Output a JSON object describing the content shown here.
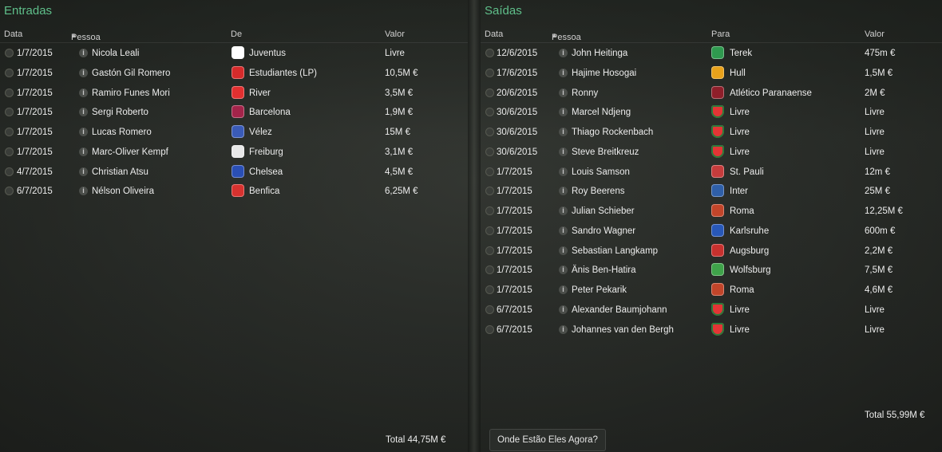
{
  "left": {
    "title": "Entradas",
    "headers": {
      "date": "Data",
      "person": "Pessoa",
      "club": "De",
      "value": "Valor"
    },
    "rows": [
      {
        "date": "1/7/2015",
        "person": "Nicola Leali",
        "club": "Juventus",
        "value": "Livre",
        "crest": "juventus-crest-icon",
        "color": "#ffffff"
      },
      {
        "date": "1/7/2015",
        "person": "Gastón Gil Romero",
        "club": "Estudiantes (LP)",
        "value": "10,5M €",
        "crest": "estudiantes-crest-icon",
        "color": "#d62b2b"
      },
      {
        "date": "1/7/2015",
        "person": "Ramiro Funes Mori",
        "club": "River",
        "value": "3,5M €",
        "crest": "river-crest-icon",
        "color": "#e23030"
      },
      {
        "date": "1/7/2015",
        "person": "Sergi Roberto",
        "club": "Barcelona",
        "value": "1,9M €",
        "crest": "barcelona-crest-icon",
        "color": "#a3244a"
      },
      {
        "date": "1/7/2015",
        "person": "Lucas Romero",
        "club": "Vélez",
        "value": "15M €",
        "crest": "velez-crest-icon",
        "color": "#3a5bb8"
      },
      {
        "date": "1/7/2015",
        "person": "Marc-Oliver Kempf",
        "club": "Freiburg",
        "value": "3,1M €",
        "crest": "freiburg-crest-icon",
        "color": "#e8e8e8"
      },
      {
        "date": "4/7/2015",
        "person": "Christian Atsu",
        "club": "Chelsea",
        "value": "4,5M €",
        "crest": "chelsea-crest-icon",
        "color": "#2a4fb5"
      },
      {
        "date": "6/7/2015",
        "person": "Nélson Oliveira",
        "club": "Benfica",
        "value": "6,25M €",
        "crest": "benfica-crest-icon",
        "color": "#d8322f"
      }
    ],
    "total": "Total  44,75M €"
  },
  "right": {
    "title": "Saídas",
    "headers": {
      "date": "Data",
      "person": "Pessoa",
      "club": "Para",
      "value": "Valor"
    },
    "rows": [
      {
        "date": "12/6/2015",
        "person": "John Heitinga",
        "club": "Terek",
        "value": "475m €",
        "crest": "terek-crest-icon",
        "color": "#2f9a4f"
      },
      {
        "date": "17/6/2015",
        "person": "Hajime Hosogai",
        "club": "Hull",
        "value": "1,5M €",
        "crest": "hull-crest-icon",
        "color": "#e9a21b"
      },
      {
        "date": "20/6/2015",
        "person": "Ronny",
        "club": "Atlético Paranaense",
        "value": "2M €",
        "crest": "atletico-paranaense-crest-icon",
        "color": "#8e1f2a"
      },
      {
        "date": "30/6/2015",
        "person": "Marcel Ndjeng",
        "club": "Livre",
        "value": "Livre",
        "crest": "free-agent-shield-icon",
        "color": "#e33535"
      },
      {
        "date": "30/6/2015",
        "person": "Thiago Rockenbach",
        "club": "Livre",
        "value": "Livre",
        "crest": "free-agent-shield-icon",
        "color": "#e33535"
      },
      {
        "date": "30/6/2015",
        "person": "Steve Breitkreuz",
        "club": "Livre",
        "value": "Livre",
        "crest": "free-agent-shield-icon",
        "color": "#e33535"
      },
      {
        "date": "1/7/2015",
        "person": "Louis Samson",
        "club": "St. Pauli",
        "value": "12m €",
        "crest": "st-pauli-crest-icon",
        "color": "#c63c3c"
      },
      {
        "date": "1/7/2015",
        "person": "Roy Beerens",
        "club": "Inter",
        "value": "25M €",
        "crest": "inter-crest-icon",
        "color": "#2f5fa8"
      },
      {
        "date": "1/7/2015",
        "person": "Julian Schieber",
        "club": "Roma",
        "value": "12,25M €",
        "crest": "roma-crest-icon",
        "color": "#c2452a"
      },
      {
        "date": "1/7/2015",
        "person": "Sandro Wagner",
        "club": "Karlsruhe",
        "value": "600m €",
        "crest": "karlsruhe-crest-icon",
        "color": "#2858b8"
      },
      {
        "date": "1/7/2015",
        "person": "Sebastian Langkamp",
        "club": "Augsburg",
        "value": "2,2M €",
        "crest": "augsburg-crest-icon",
        "color": "#c8312e"
      },
      {
        "date": "1/7/2015",
        "person": "Änis Ben-Hatira",
        "club": "Wolfsburg",
        "value": "7,5M €",
        "crest": "wolfsburg-crest-icon",
        "color": "#3fa34a"
      },
      {
        "date": "1/7/2015",
        "person": "Peter Pekarik",
        "club": "Roma",
        "value": "4,6M €",
        "crest": "roma-crest-icon",
        "color": "#c2452a"
      },
      {
        "date": "6/7/2015",
        "person": "Alexander Baumjohann",
        "club": "Livre",
        "value": "Livre",
        "crest": "free-agent-shield-icon",
        "color": "#e33535"
      },
      {
        "date": "6/7/2015",
        "person": "Johannes van den Bergh",
        "club": "Livre",
        "value": "Livre",
        "crest": "free-agent-shield-icon",
        "color": "#e33535"
      }
    ],
    "total": "Total  55,99M €"
  },
  "where_button": "Onde Estão Eles Agora?",
  "accent_color": "#5fbf8a"
}
